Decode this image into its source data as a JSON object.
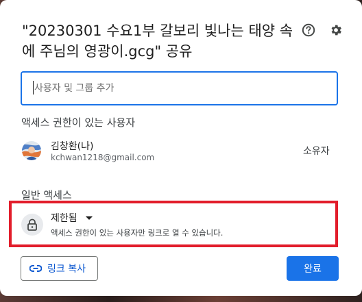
{
  "dialog": {
    "title": "\"20230301 수요1부 갈보리 빛나는 태양 속에 주님의 영광이.gcg\" 공유"
  },
  "icons": {
    "help": "help-circle-icon",
    "settings": "gear-icon",
    "lock": "lock-icon",
    "link": "link-icon",
    "dropdown": "caret-down-icon"
  },
  "share": {
    "placeholder": "사용자 및 그룹 추가"
  },
  "people": {
    "heading": "액세스 권한이 있는 사용자",
    "users": [
      {
        "name": "김창환(나)",
        "email": "kchwan1218@gmail.com",
        "role": "소유자"
      }
    ]
  },
  "general": {
    "heading": "일반 액세스",
    "access_level": "제한됨",
    "description": "액세스 권한이 있는 사용자만 링크로 열 수 있습니다."
  },
  "footer": {
    "copy_link_label": "링크 복사",
    "done_label": "완료"
  },
  "colors": {
    "accent": "#1a73e8",
    "highlight_border": "#e21d2b"
  }
}
